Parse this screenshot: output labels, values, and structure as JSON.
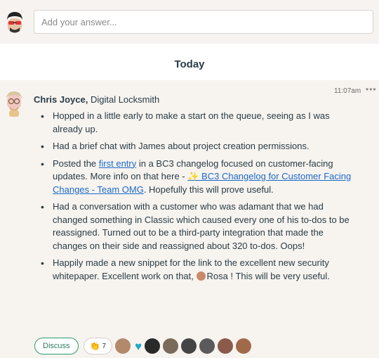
{
  "compose": {
    "placeholder": "Add your answer...",
    "avatar_icon": "sunglasses-avatar-icon"
  },
  "day_label": "Today",
  "entry": {
    "author": "Chris Joyce,",
    "role": "Digital Locksmith",
    "time": "11:07am",
    "more": "•••",
    "bullets": [
      {
        "text": "Hopped in a little early to make a start on the queue, seeing as I was already up."
      },
      {
        "text": "Had a brief chat with James about project creation permissions."
      },
      {
        "pre": "Posted the ",
        "link1": "first entry",
        "mid": " in a BC3 changelog focused on customer-facing updates. More info on that here - ",
        "sparkle": "✨",
        "link2": "BC3 Changelog for Customer Facing Changes - Team OMG",
        "post": ". Hopefully this will prove useful."
      },
      {
        "text": "Had a conversation with a customer who was adamant that we had changed something in Classic which caused every one of his to-dos to be reassigned. Turned out to be a third-party integration that made the changes on their side and reassigned about 320 to-dos. Oops!"
      },
      {
        "pre": "Happily made a new snippet for the link to the excellent new security whitepaper. Excellent work on that, ",
        "mention": "Rosa",
        "post": " ! This will be very useful."
      }
    ]
  },
  "actions": {
    "discuss_label": "Discuss",
    "boost_count": "7",
    "boost_colors": [
      "#b3896b",
      "#2a2a2a",
      "#7a6a5a",
      "#444444",
      "#5a5a5a",
      "#8a5a4a",
      "#a06a4a"
    ]
  },
  "colors": {
    "link": "#1b6ac9",
    "discuss": "#2d9a6f",
    "heart": "#23a6c9",
    "background": "#f7f3ef"
  }
}
